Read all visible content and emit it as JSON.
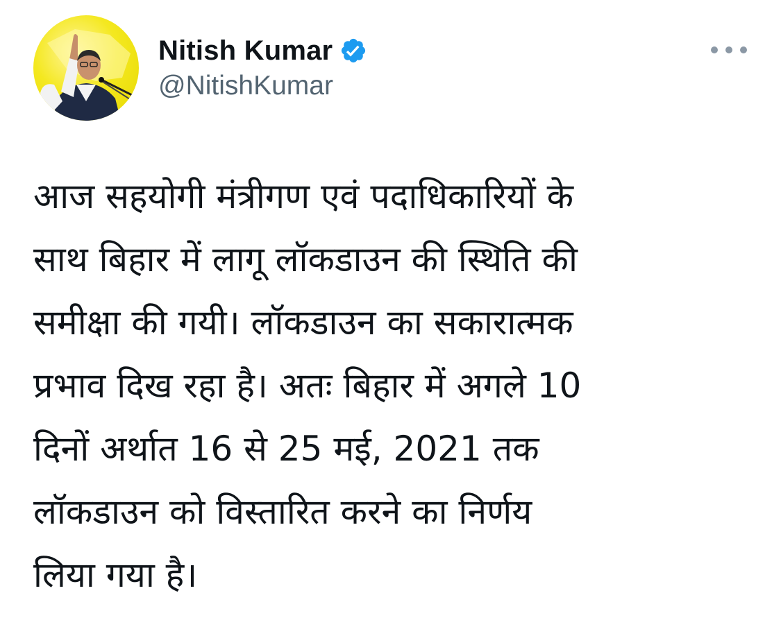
{
  "user": {
    "display_name": "Nitish Kumar",
    "handle": "@NitishKumar",
    "verified": true,
    "avatar_icon": "profile-photo"
  },
  "more_icon": "ellipsis-icon",
  "verified_icon": "verified-badge-icon",
  "colors": {
    "verified_blue": "#1d9bf0",
    "handle_gray": "#536471",
    "text": "#0f1419",
    "avatar_bg": "#f4e81f"
  },
  "tweet": {
    "lines": [
      "आज सहयोगी मंत्रीगण एवं पदाधिकारियों के",
      "साथ बिहार में लागू लॉकडाउन की स्थिति की",
      "समीक्षा की गयी। लॉकडाउन का सकारात्मक",
      "प्रभाव दिख रहा है। अतः बिहार में अगले 10",
      "दिनों अर्थात 16 से 25 मई, 2021 तक",
      "लॉकडाउन को विस्तारित करने का निर्णय",
      "लिया गया है।"
    ]
  }
}
